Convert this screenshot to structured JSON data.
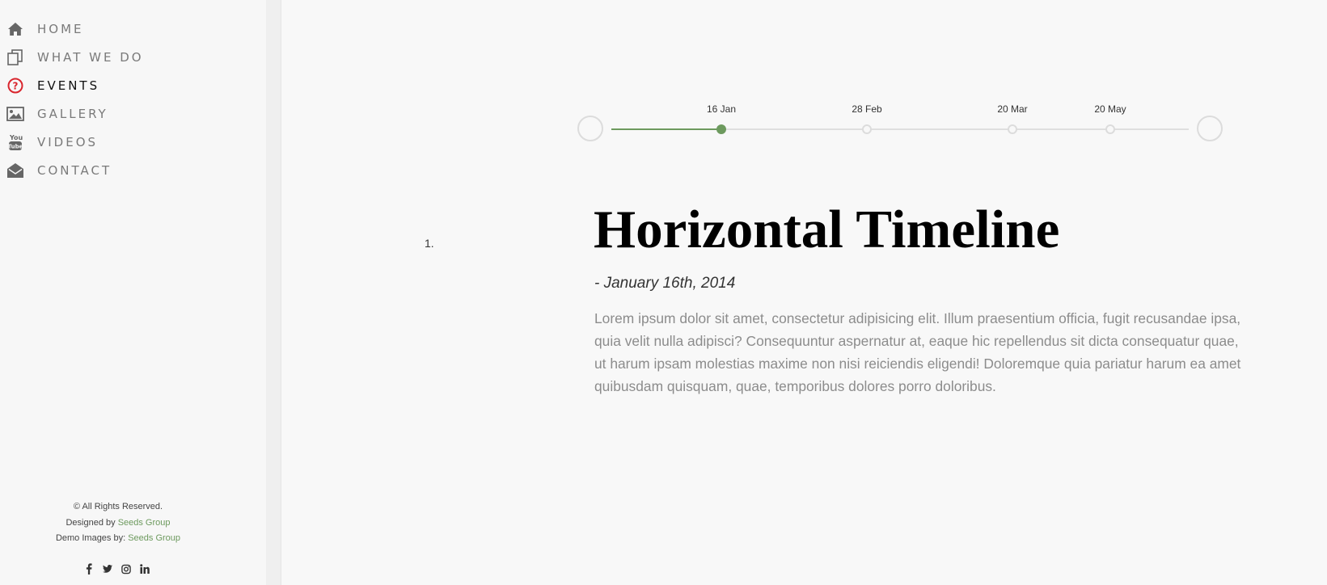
{
  "sidebar": {
    "items": [
      {
        "label": "HOME",
        "icon": "home-icon"
      },
      {
        "label": "WHAT WE DO",
        "icon": "copy-icon"
      },
      {
        "label": "EVENTS",
        "icon": "question-circle-icon",
        "active": true
      },
      {
        "label": "GALLERY",
        "icon": "image-icon"
      },
      {
        "label": "VIDEOS",
        "icon": "youtube-icon"
      },
      {
        "label": "CONTACT",
        "icon": "envelope-open-icon"
      }
    ],
    "footer": {
      "rights": "© All Rights Reserved.",
      "designed_prefix": "Designed by",
      "designed_link": "Seeds Group",
      "images_prefix": "Demo Images by:",
      "images_link": "Seeds Group"
    },
    "social": [
      "facebook-icon",
      "twitter-icon",
      "instagram-icon",
      "linkedin-icon"
    ]
  },
  "timeline": {
    "dates": [
      "16 Jan",
      "28 Feb",
      "20 Mar",
      "20 May"
    ],
    "selected": "16 Jan"
  },
  "content": {
    "list_number": "1.",
    "title": "Horizontal Timeline",
    "date": "- January 16th, 2014",
    "body": "Lorem ipsum dolor sit amet, consectetur adipisicing elit. Illum praesentium officia, fugit recusandae ipsa, quia velit nulla adipisci? Consequuntur aspernatur at, eaque hic repellendus sit dicta consequatur quae, ut harum ipsam molestias maxime non nisi reiciendis eligendi! Doloremque quia pariatur harum ea amet quibusdam quisquam, quae, temporibus dolores porro doloribus."
  },
  "colors": {
    "accent": "#6d9a5e",
    "events_icon": "#d9262e",
    "nav_text": "#7a7a7a"
  }
}
